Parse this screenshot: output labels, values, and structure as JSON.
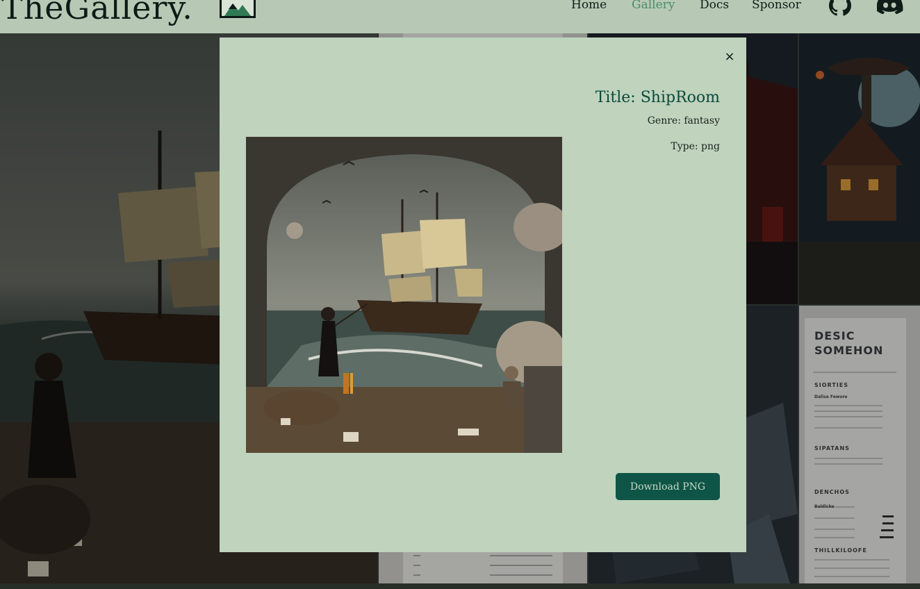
{
  "header": {
    "logo_text": "TheGallery.",
    "nav": [
      "Home",
      "Gallery",
      "Docs",
      "Sponsor"
    ],
    "active_nav": "Gallery",
    "icons": [
      "github-icon",
      "discord-icon"
    ]
  },
  "gallery": {
    "tile_images": [
      "ship-room-scene",
      "document-page",
      "dark-city-scene",
      "mushroom-house-scene",
      "abstract-blocks-scene",
      "resume-page"
    ],
    "resume_tile": {
      "heading_1": "DESIC",
      "heading_2": "SOMEHON",
      "section_1": "SIORTIES",
      "section_1_item": "Dalise Fewore",
      "section_2": "SIPATANS",
      "section_3": "DENCHOS",
      "section_3_item": "Baldicke",
      "section_4": "THILLKILOOFE"
    }
  },
  "modal": {
    "close_label": "×",
    "title": "Title: ShipRoom",
    "genre": "Genre: fantasy",
    "type": "Type: png",
    "download_label": "Download PNG"
  },
  "colors": {
    "header_bg": "#b7c9b5",
    "modal_bg": "#bfd3bd",
    "accent": "#0f5547",
    "title": "#0b4a3b",
    "active_nav": "#4b8b6b"
  }
}
